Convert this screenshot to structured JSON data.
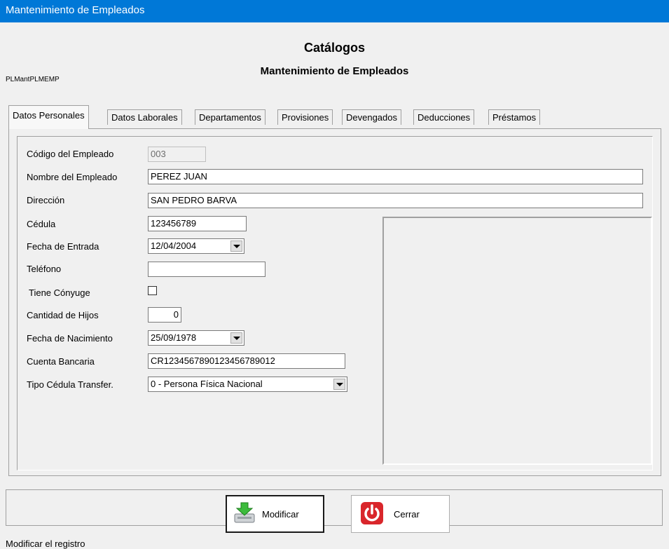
{
  "window": {
    "title": "Mantenimiento de Empleados"
  },
  "header": {
    "title": "Catálogos",
    "subtitle": "Mantenimiento de Empleados",
    "form_code": "PLMantPLMEMP"
  },
  "tabs": [
    {
      "label": "Datos Personales",
      "active": true
    },
    {
      "label": "Datos Laborales"
    },
    {
      "label": "Departamentos"
    },
    {
      "label": "Provisiones"
    },
    {
      "label": "Devengados"
    },
    {
      "label": "Deducciones"
    },
    {
      "label": "Préstamos"
    }
  ],
  "form": {
    "codigo": {
      "label": "Código del Empleado",
      "value": "003"
    },
    "nombre": {
      "label": "Nombre del Empleado",
      "value": "PEREZ JUAN"
    },
    "direccion": {
      "label": "Dirección",
      "value": "SAN PEDRO BARVA"
    },
    "cedula": {
      "label": "Cédula",
      "value": "123456789"
    },
    "fecha_entrada": {
      "label": "Fecha de Entrada",
      "value": "12/04/2004"
    },
    "telefono": {
      "label": "Teléfono",
      "value": ""
    },
    "conyuge": {
      "label": "Tiene Cónyuge",
      "checked": false
    },
    "hijos": {
      "label": "Cantidad de Hijos",
      "value": "0"
    },
    "fecha_nacimiento": {
      "label": "Fecha de Nacimiento",
      "value": "25/09/1978"
    },
    "cuenta": {
      "label": "Cuenta Bancaria",
      "value": "CR1234567890123456789012"
    },
    "tipo_cedula": {
      "label": "Tipo Cédula Transfer.",
      "value": "0 - Persona Física Nacional"
    }
  },
  "buttons": {
    "modify": {
      "label": "Modificar",
      "icon": "inbox-download-icon",
      "icon_color": "#3dbb3d"
    },
    "close": {
      "label": "Cerrar",
      "icon": "power-icon",
      "icon_color": "#d9262b"
    }
  },
  "status": {
    "text": "Modificar el registro"
  }
}
